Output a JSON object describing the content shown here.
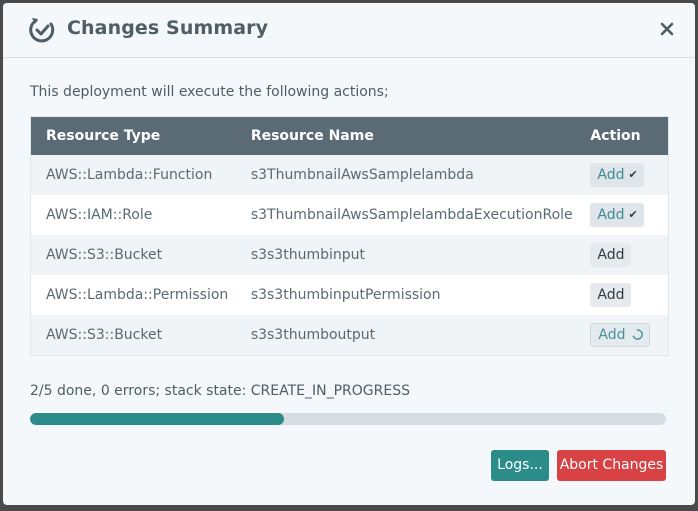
{
  "dialog": {
    "title": "Changes Summary",
    "icon": "deploy-cycle-icon",
    "close_icon": "close-icon"
  },
  "intro": "This deployment will execute the following actions;",
  "table": {
    "headers": {
      "type": "Resource Type",
      "name": "Resource Name",
      "action": "Action"
    },
    "rows": [
      {
        "type": "AWS::Lambda::Function",
        "name": "s3ThumbnailAwsSamplelambda",
        "action": "Add",
        "state": "done"
      },
      {
        "type": "AWS::IAM::Role",
        "name": "s3ThumbnailAwsSamplelambdaExecutionRole",
        "action": "Add",
        "state": "done"
      },
      {
        "type": "AWS::S3::Bucket",
        "name": "s3s3thumbinput",
        "action": "Add",
        "state": "pending"
      },
      {
        "type": "AWS::Lambda::Permission",
        "name": "s3s3thumbinputPermission",
        "action": "Add",
        "state": "pending"
      },
      {
        "type": "AWS::S3::Bucket",
        "name": "s3s3thumboutput",
        "action": "Add",
        "state": "in-progress"
      }
    ]
  },
  "status": "2/5 done, 0 errors; stack state: CREATE_IN_PROGRESS",
  "progress": {
    "fraction": 0.4
  },
  "buttons": {
    "logs": "Logs...",
    "abort": "Abort Changes"
  },
  "colors": {
    "accent": "#2b8c8a",
    "danger": "#d94245",
    "header_bg": "#5a6b75"
  }
}
